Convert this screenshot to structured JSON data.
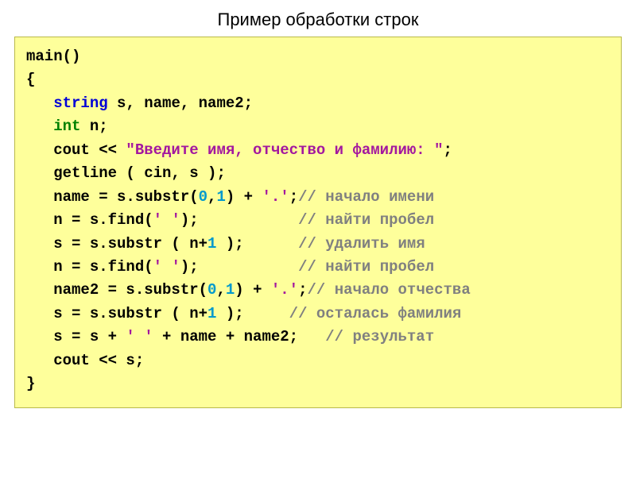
{
  "title": "Пример обработки строк",
  "code": {
    "l1a": "main()",
    "l2a": "{",
    "l3_kw": "string",
    "l3_rest": " s, name, name2;",
    "l4_kw": "int",
    "l4_rest": " n;",
    "l5a": "   cout << ",
    "l5_str": "\"Введите имя, отчество и фамилию: \"",
    "l5b": ";",
    "l6a": "   getline ( cin, s );",
    "l7a": "   name = s.substr(",
    "l7_n1": "0",
    "l7_c": ",",
    "l7_n2": "1",
    "l7_b": ") + ",
    "l7_str": "'.'",
    "l7_sc": ";",
    "l7_com": "// начало имени",
    "l8a": "   n = s.find(",
    "l8_str": "' '",
    "l8b": ");           ",
    "l8_com": "// найти пробел",
    "l9a": "   s = s.substr ( n+",
    "l9_n": "1",
    "l9b": " );      ",
    "l9_com": "// удалить имя",
    "l10a": "   n = s.find(",
    "l10_str": "' '",
    "l10b": ");           ",
    "l10_com": "// найти пробел",
    "l11a": "   name2 = s.substr(",
    "l11_n1": "0",
    "l11_c": ",",
    "l11_n2": "1",
    "l11_b": ") + ",
    "l11_str": "'.'",
    "l11_sc": ";",
    "l11_com": "// начало отчества",
    "l12a": "   s = s.substr ( n+",
    "l12_n": "1",
    "l12b": " );     ",
    "l12_com": "// осталась фамилия",
    "l13a": "   s = s + ",
    "l13_str": "' '",
    "l13b": " + name + name2;   ",
    "l13_com": "// результат",
    "l14a": "   cout << s;",
    "l15a": "}"
  }
}
